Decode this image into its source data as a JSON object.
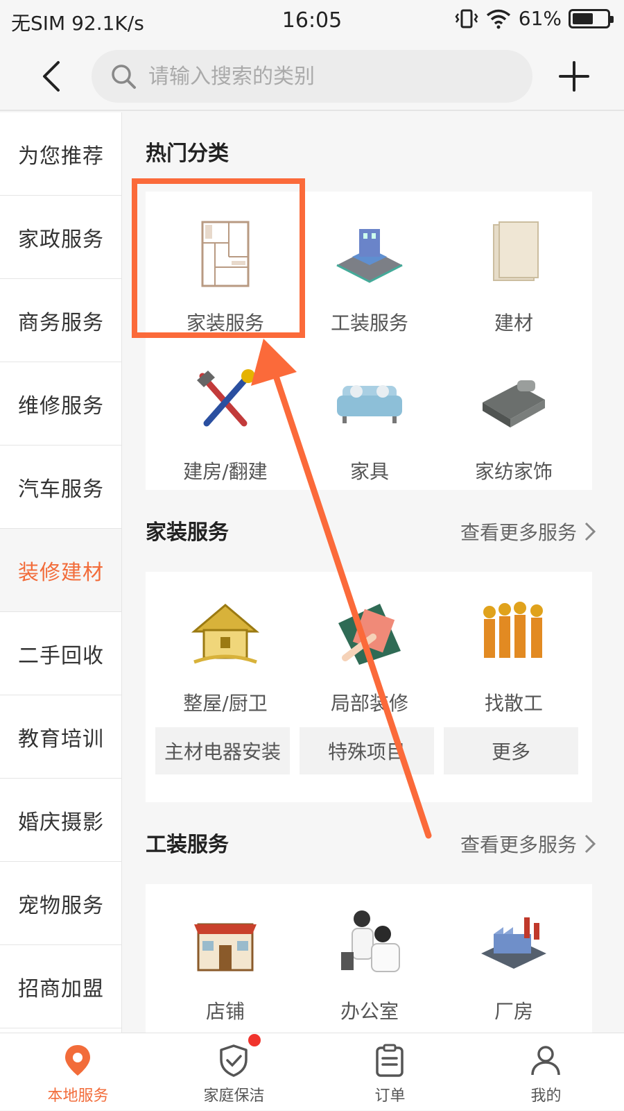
{
  "status": {
    "carrier": "无SIM 92.1K/s",
    "time": "16:05",
    "battery": "61%",
    "battery_level": 0.61
  },
  "header": {
    "search_placeholder": "请输入搜索的类别"
  },
  "sidebar": {
    "items": [
      {
        "label": "为您推荐"
      },
      {
        "label": "家政服务"
      },
      {
        "label": "商务服务"
      },
      {
        "label": "维修服务"
      },
      {
        "label": "汽车服务"
      },
      {
        "label": "装修建材"
      },
      {
        "label": "二手回收"
      },
      {
        "label": "教育培训"
      },
      {
        "label": "婚庆摄影"
      },
      {
        "label": "宠物服务"
      },
      {
        "label": "招商加盟"
      }
    ],
    "active_label": "装修建材"
  },
  "hot": {
    "title": "热门分类",
    "items": [
      {
        "label": "家装服务"
      },
      {
        "label": "工装服务"
      },
      {
        "label": "建材"
      },
      {
        "label": "建房/翻建"
      },
      {
        "label": "家具"
      },
      {
        "label": "家纺家饰"
      }
    ]
  },
  "home_deco": {
    "title": "家装服务",
    "more": "查看更多服务",
    "items": [
      {
        "label": "整屋/厨卫"
      },
      {
        "label": "局部装修"
      },
      {
        "label": "找散工"
      }
    ],
    "chips": [
      "主材电器安装",
      "特殊项目",
      "更多"
    ]
  },
  "tooling": {
    "title": "工装服务",
    "more": "查看更多服务",
    "items": [
      {
        "label": "店铺"
      },
      {
        "label": "办公室"
      },
      {
        "label": "厂房"
      }
    ]
  },
  "tabs": [
    {
      "label": "本地服务"
    },
    {
      "label": "家庭保洁"
    },
    {
      "label": "订单"
    },
    {
      "label": "我的"
    }
  ],
  "colors": {
    "accent": "#f26c3a",
    "highlight": "#fb6a3a",
    "badge": "#f0332c"
  }
}
